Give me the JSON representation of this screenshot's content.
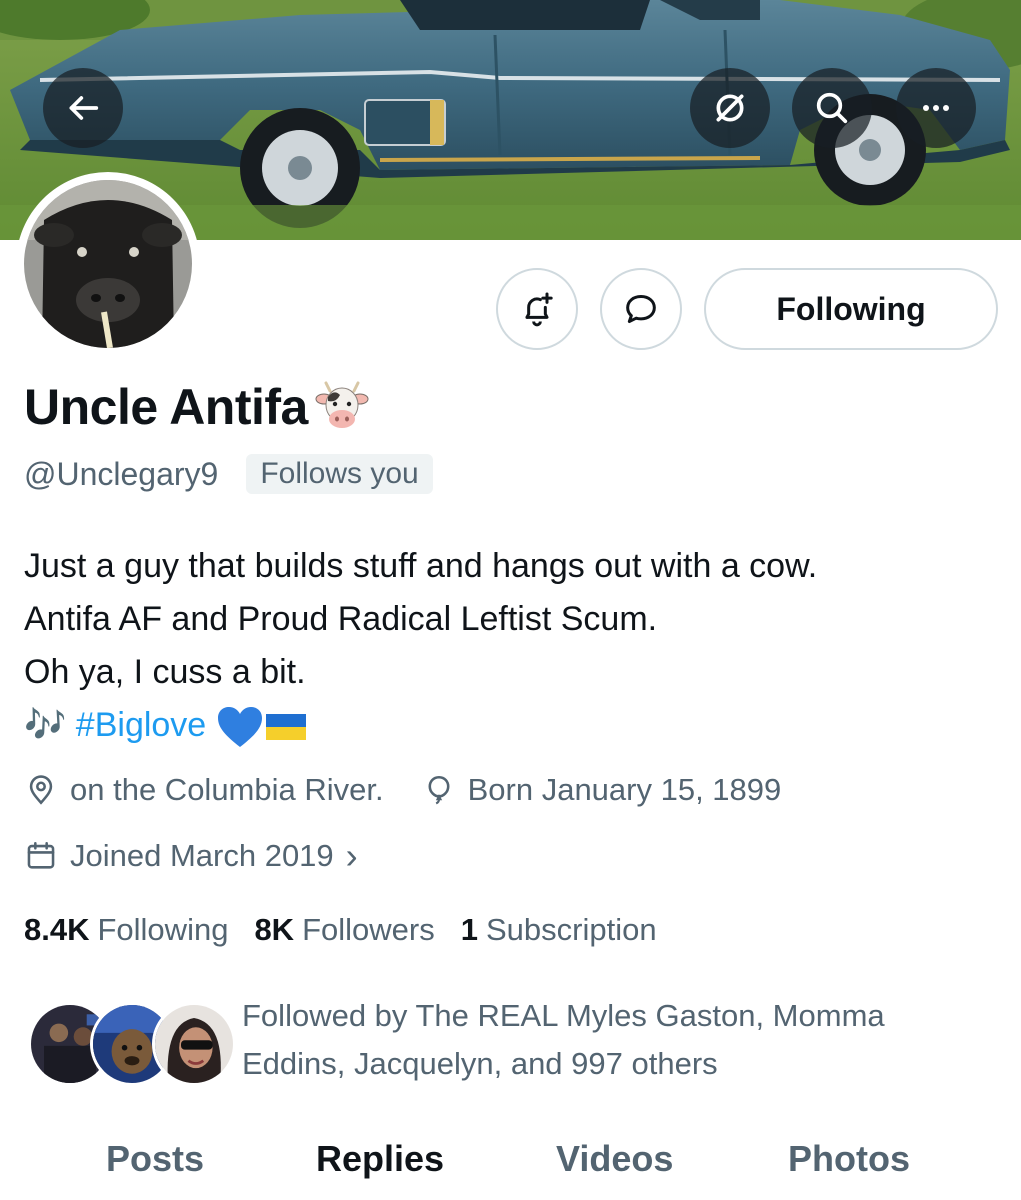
{
  "header": {
    "back_icon": "arrow-left-icon",
    "grok_icon": "slashed-circle-icon",
    "search_icon": "search-icon",
    "more_icon": "more-horizontal-icon"
  },
  "banner": {
    "subject": "classic-blue-car"
  },
  "actions": {
    "notify_icon": "bell-plus-icon",
    "message_icon": "message-bubble-icon",
    "following_label": "Following"
  },
  "profile": {
    "name": "Uncle Antifa",
    "name_emoji": "🐮",
    "handle": "@Unclegary9",
    "follows_you": "Follows you",
    "bio_lines": [
      "Just a guy that builds stuff and hangs out with a cow.",
      "Antifa AF and Proud Radical Leftist Scum.",
      "Oh ya, I cuss a bit."
    ],
    "bio_music": "🎶",
    "bio_hashtag": "#Biglove",
    "bio_heart": "💙",
    "bio_flag": "🇺🇦",
    "location": "on the Columbia River.",
    "born": "Born January 15, 1899",
    "joined": "Joined March 2019",
    "joined_chevron": "›"
  },
  "stats": {
    "following_count": "8.4K",
    "following_label": "Following",
    "followers_count": "8K",
    "followers_label": "Followers",
    "subscription_count": "1",
    "subscription_label": "Subscription"
  },
  "followed_by": {
    "text": "Followed by The REAL Myles Gaston, Momma Eddins, Jacquelyn, and 997 others"
  },
  "tabs": [
    {
      "label": "Posts"
    },
    {
      "label": "Replies"
    },
    {
      "label": "Videos"
    },
    {
      "label": "Photos"
    }
  ],
  "colors": {
    "accent": "#1d9bf0",
    "text_primary": "#0f1419",
    "text_secondary": "#536471",
    "border": "#cfd9de"
  }
}
